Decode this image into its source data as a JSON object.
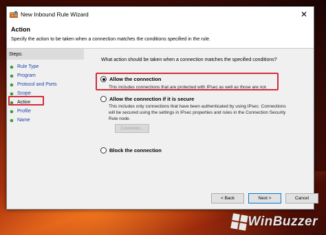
{
  "window": {
    "title": "New Inbound Rule Wizard",
    "close_glyph": "✕"
  },
  "header": {
    "title": "Action",
    "subtitle": "Specify the action to be taken when a connection matches the conditions specified in the rule."
  },
  "steps": {
    "title": "Steps:",
    "items": [
      {
        "label": "Rule Type"
      },
      {
        "label": "Program"
      },
      {
        "label": "Protocol and Ports"
      },
      {
        "label": "Scope"
      },
      {
        "label": "Action"
      },
      {
        "label": "Profile"
      },
      {
        "label": "Name"
      }
    ],
    "active_index": 4
  },
  "main": {
    "question": "What action should be taken when a connection matches the specified conditions?",
    "options": [
      {
        "label": "Allow the connection",
        "desc": "This includes connections that are protected with IPsec as well as those are not.",
        "selected": true
      },
      {
        "label": "Allow the connection if it is secure",
        "desc": "This includes only connections that have been authenticated by using IPsec.  Connections will be secured using the settings in IPsec properties and rules in the Connection Security Rule node.",
        "selected": false
      },
      {
        "label": "Block the connection",
        "selected": false
      }
    ],
    "customize_label": "Customize..."
  },
  "buttons": {
    "back": "< Back",
    "next": "Next >",
    "cancel": "Cancel"
  },
  "watermark": {
    "text": "WinBuzzer"
  },
  "colors": {
    "highlight": "#d32a3a",
    "step_link": "#1a3fae",
    "step_dot": "#3a9a3a"
  }
}
